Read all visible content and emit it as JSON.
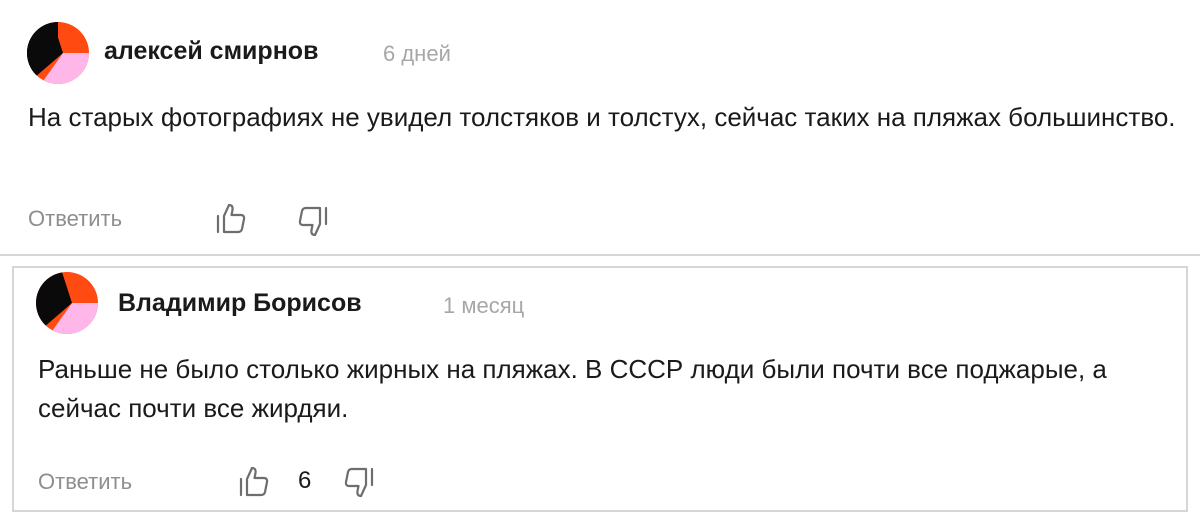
{
  "comments": [
    {
      "author": "алексей смирнов",
      "time": "6 дней",
      "text": "На старых фотографиях не увидел толстяков и толстух, сейчас таких на пляжах большинство.",
      "reply_label": "Ответить",
      "likes": null
    },
    {
      "author": "Владимир Борисов",
      "time": "1 месяц",
      "text": "Раньше не было столько жирных на пляжах. В СССР люди были почти все поджарые, а сейчас почти все жирдяи.",
      "reply_label": "Ответить",
      "likes": "6"
    }
  ],
  "colors": {
    "avatar_orange": "#ff4a12",
    "avatar_black": "#0a0a0a",
    "avatar_pink": "#ffb6e8",
    "muted_text": "#8e8e8e",
    "divider": "#d6d6d6"
  },
  "icons": {
    "like": "thumbs-up-icon",
    "dislike": "thumbs-down-icon"
  }
}
